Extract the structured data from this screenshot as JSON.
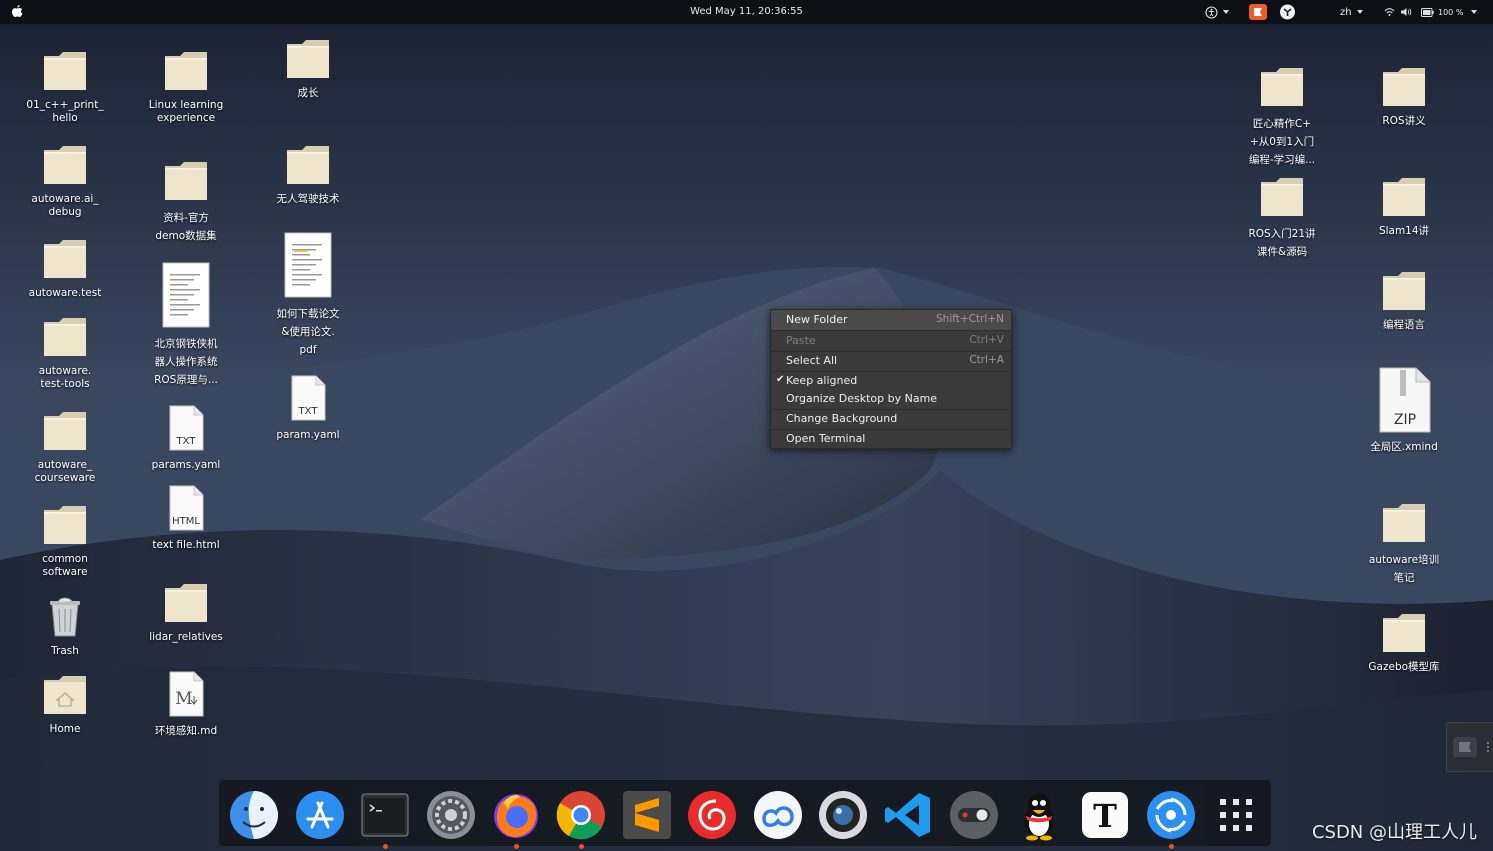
{
  "topbar": {
    "clock": "Wed May 11, 20:36:55",
    "language": "zh",
    "battery": "100 %"
  },
  "desktop_icons_left": [
    {
      "label": "01_c++_print_\nhello",
      "type": "folder"
    },
    {
      "label": "autoware.ai_\ndebug",
      "type": "folder"
    },
    {
      "label": "autoware.test",
      "type": "folder"
    },
    {
      "label": "autoware.\ntest-tools",
      "type": "folder"
    },
    {
      "label": "autoware_\ncourseware",
      "type": "folder"
    },
    {
      "label": "common\nsoftware",
      "type": "folder"
    },
    {
      "label": "Trash",
      "type": "trash"
    },
    {
      "label": "Home",
      "type": "home"
    }
  ],
  "desktop_icons_mid": [
    {
      "label": "Linux learning\nexperience",
      "type": "folder"
    },
    {
      "label": "资料-官方\ndemo数据集",
      "type": "folder"
    },
    {
      "label": "北京钢铁侠机\n器人操作系统\nROS原理与...",
      "type": "doc"
    },
    {
      "label": "params.yaml",
      "type": "txt",
      "badge": "TXT"
    },
    {
      "label": "text file.html",
      "type": "html",
      "badge": "HTML"
    },
    {
      "label": "lidar_relatives",
      "type": "folder"
    },
    {
      "label": "环境感知.md",
      "type": "md"
    }
  ],
  "desktop_icons_right_col": [
    {
      "label": "成长",
      "type": "folder"
    },
    {
      "label": "无人驾驶技术",
      "type": "folder"
    },
    {
      "label": "如何下载论文\n&使用论文.\npdf",
      "type": "pdf"
    },
    {
      "label": "param.yaml",
      "type": "txt",
      "badge": "TXT"
    }
  ],
  "desktop_icons_far_right_a": [
    {
      "label": "匠心精作C+\n+从0到1入门\n编程-学习编...",
      "type": "folder"
    },
    {
      "label": "ROS入门21讲\n课件&源码",
      "type": "folder"
    }
  ],
  "desktop_icons_far_right_b": [
    {
      "label": "ROS讲义",
      "type": "folder"
    },
    {
      "label": "Slam14讲",
      "type": "folder"
    },
    {
      "label": "编程语言",
      "type": "folder"
    },
    {
      "label": "全局区.xmind",
      "type": "zip",
      "badge": "ZIP"
    },
    {
      "label": "autoware培训\n笔记",
      "type": "folder"
    },
    {
      "label": "Gazebo模型库",
      "type": "folder"
    }
  ],
  "context_menu": [
    {
      "label": "New Folder",
      "shortcut": "Shift+Ctrl+N",
      "enabled": true
    },
    {
      "label": "Paste",
      "shortcut": "Ctrl+V",
      "enabled": false
    },
    {
      "label": "Select All",
      "shortcut": "Ctrl+A",
      "enabled": true
    },
    {
      "label": "Keep aligned",
      "shortcut": "",
      "enabled": true,
      "checked": true
    },
    {
      "label": "Organize Desktop by Name",
      "shortcut": "",
      "enabled": true
    },
    {
      "label": "Change Background",
      "shortcut": "",
      "enabled": true
    },
    {
      "label": "Open Terminal",
      "shortcut": "",
      "enabled": true
    }
  ],
  "dock_apps": [
    {
      "name": "finder-icon"
    },
    {
      "name": "app-store-icon"
    },
    {
      "name": "terminal-icon",
      "running": true
    },
    {
      "name": "system-settings-icon"
    },
    {
      "name": "firefox-icon",
      "running": true
    },
    {
      "name": "chrome-icon",
      "running": true
    },
    {
      "name": "sublime-text-icon"
    },
    {
      "name": "netease-music-icon"
    },
    {
      "name": "baidu-netdisk-icon"
    },
    {
      "name": "camera-icon"
    },
    {
      "name": "vscode-icon"
    },
    {
      "name": "toggle-switch-icon"
    },
    {
      "name": "qq-penguin-icon"
    },
    {
      "name": "typora-icon"
    },
    {
      "name": "feishu-icon",
      "running": true
    },
    {
      "name": "show-applications-icon"
    }
  ],
  "watermark": "CSDN @山理工人儿",
  "colors": {
    "folder": "#efe4cc",
    "topbar": "#0d0f14",
    "menu_bg": "#3a3a3a",
    "running_dot": "#e95420"
  }
}
